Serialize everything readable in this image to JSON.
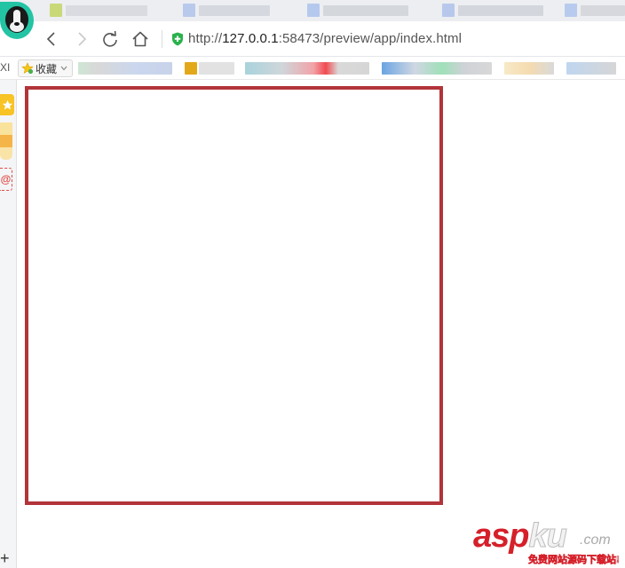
{
  "browser": {
    "address_bar": {
      "scheme": "http://",
      "host": "127.0.0.1",
      "rest": ":58473/preview/app/index.html"
    },
    "nav_icons": [
      "back-arrow-icon",
      "forward-arrow-icon",
      "reload-icon",
      "home-icon",
      "secure-shield-icon"
    ]
  },
  "bookmarks_bar": {
    "cut_text": "XI",
    "favorites_label": "收藏"
  },
  "sidebar": {
    "icons": [
      "star-icon",
      "notes-icon",
      "mail-icon",
      "add-icon"
    ],
    "mail_label": "@",
    "add_label": "+"
  },
  "page": {
    "canvas_border_color": "#b2343a"
  },
  "watermark": {
    "asp": "asp",
    "ku": "ku",
    "domain": ".com",
    "tagline": "免费网站源码下载站!"
  }
}
